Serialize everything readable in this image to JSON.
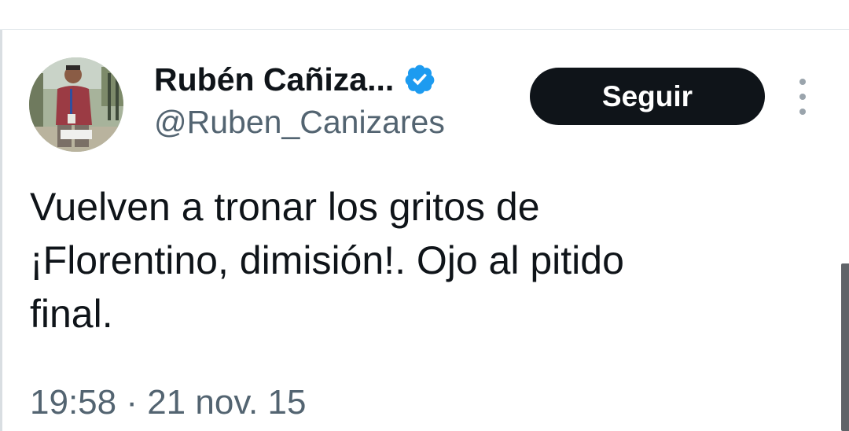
{
  "tweet": {
    "author": {
      "display_name": "Rubén Cañiza...",
      "handle": "@Ruben_Canizares",
      "verified": true,
      "verified_color": "#1d9bf0"
    },
    "follow_label": "Seguir",
    "text": "Vuelven a tronar los gritos de\n¡Florentino, dimisión!. Ojo al pitido\nfinal.",
    "timestamp": "19:58 · 21 nov. 15"
  },
  "icons": {
    "verified": "verified-badge-icon",
    "more": "more-options-icon"
  },
  "colors": {
    "text_primary": "#0f1419",
    "text_secondary": "#536471",
    "button_bg": "#0f1419",
    "button_text": "#ffffff"
  }
}
